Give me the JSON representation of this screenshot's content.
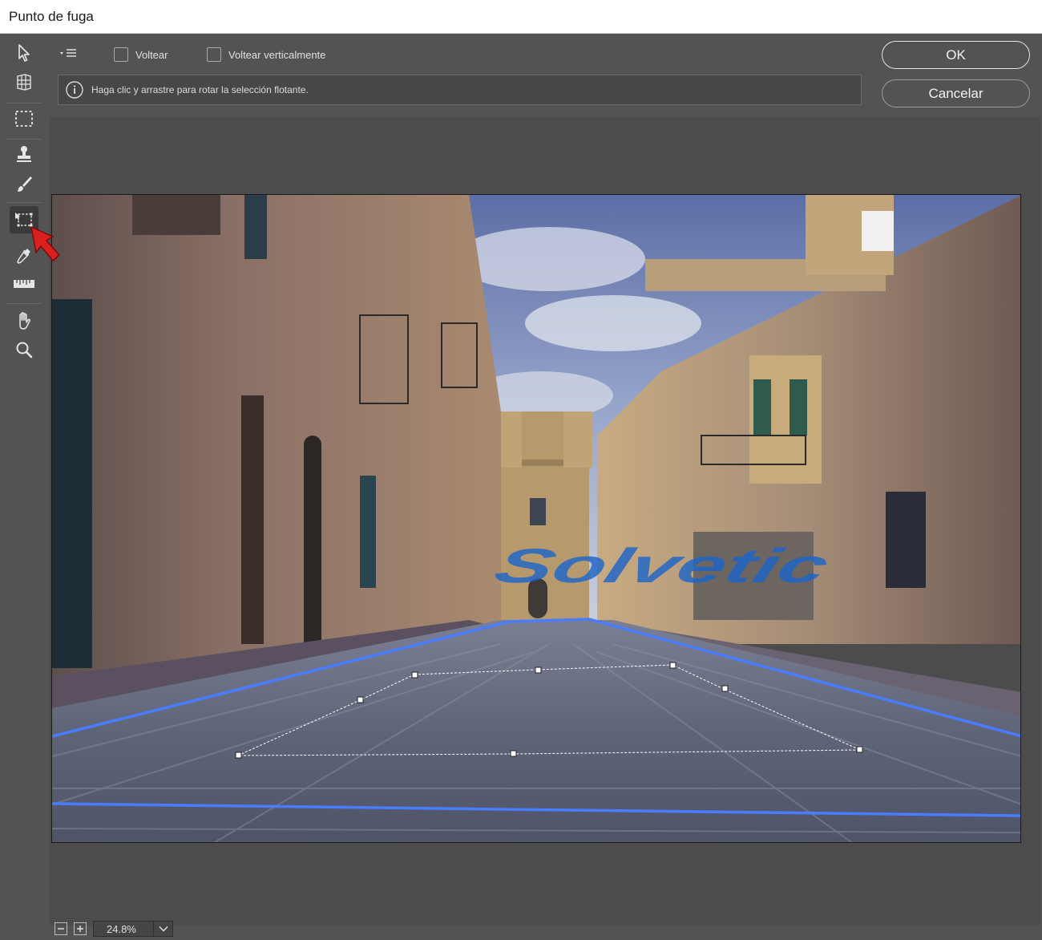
{
  "window": {
    "title": "Punto de fuga"
  },
  "options": {
    "flip_label": "Voltear",
    "flip_vertical_label": "Voltear verticalmente",
    "info_message": "Haga clic y arrastre para rotar la selección flotante."
  },
  "buttons": {
    "ok": "OK",
    "cancel": "Cancelar"
  },
  "tools": [
    {
      "name": "edit-plane-tool",
      "icon": "arrow-pointer-icon",
      "active": false
    },
    {
      "name": "create-plane-tool",
      "icon": "grid-plane-icon",
      "active": false
    },
    {
      "name": "marquee-tool",
      "icon": "dashed-rectangle-icon",
      "active": false
    },
    {
      "name": "stamp-tool",
      "icon": "stamp-icon",
      "active": false
    },
    {
      "name": "brush-tool",
      "icon": "brush-icon",
      "active": false
    },
    {
      "name": "transform-tool",
      "icon": "transform-icon",
      "active": true
    },
    {
      "name": "eyedropper-tool",
      "icon": "eyedropper-icon",
      "active": false
    },
    {
      "name": "measure-tool",
      "icon": "ruler-icon",
      "active": false
    },
    {
      "name": "hand-tool",
      "icon": "hand-icon",
      "active": false
    },
    {
      "name": "zoom-tool",
      "icon": "magnifier-icon",
      "active": false
    }
  ],
  "status": {
    "zoom": "24.8%"
  },
  "overlay": {
    "watermark_text": "Solvetic"
  },
  "colors": {
    "plane_grid": "#4a7cff",
    "annotation_arrow": "#d9201f",
    "watermark": "#1d64c8"
  }
}
